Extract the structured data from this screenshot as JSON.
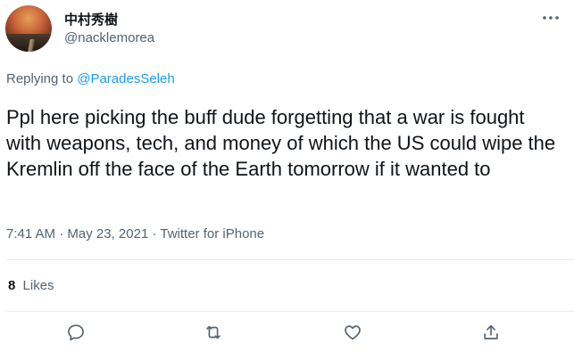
{
  "tweet": {
    "author": {
      "display_name": "中村秀樹",
      "handle": "@nacklemorea"
    },
    "reply": {
      "prefix": "Replying to",
      "mention": "@ParadesSeleh"
    },
    "text": "Ppl here picking the buff dude forgetting that a war is fought with weapons, tech, and money of which the US could wipe the Kremlin off the face of the Earth tomorrow if it wanted to",
    "meta": {
      "time": "7:41 AM",
      "separator": "·",
      "date": "May 23, 2021",
      "source": "Twitter for iPhone"
    },
    "stats": {
      "likes_count": "8",
      "likes_label": "Likes"
    },
    "actions": [
      {
        "name": "reply",
        "icon": "reply-icon"
      },
      {
        "name": "retweet",
        "icon": "retweet-icon"
      },
      {
        "name": "like",
        "icon": "heart-icon"
      },
      {
        "name": "share",
        "icon": "share-icon"
      }
    ]
  },
  "colors": {
    "text_primary": "#0f1419",
    "text_secondary": "#536471",
    "link": "#1d9bf0",
    "divider": "#e6ecf0"
  }
}
